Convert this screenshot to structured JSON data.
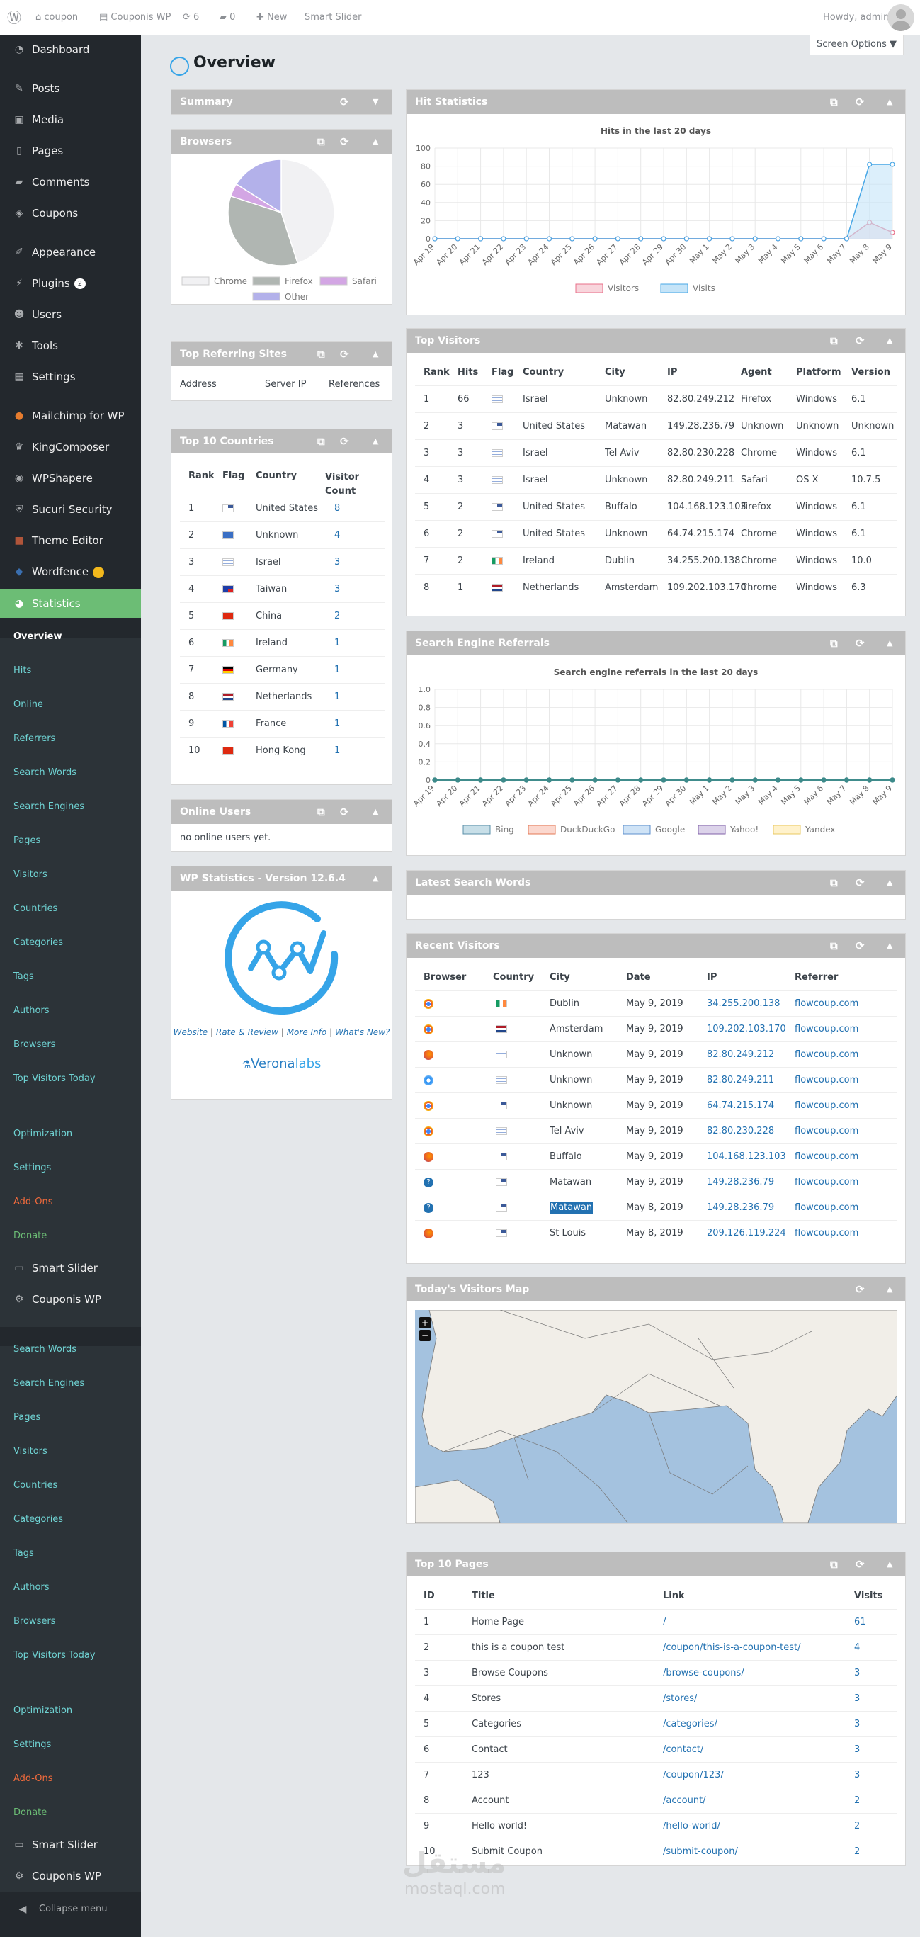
{
  "adminbar": {
    "site": "coupon",
    "site2": "Couponis WP",
    "updates": "6",
    "comments": "0",
    "new": "New",
    "smart_slider": "Smart Slider",
    "howdy": "Howdy, ",
    "user": "admin"
  },
  "menu": {
    "dashboard": "Dashboard",
    "posts": "Posts",
    "media": "Media",
    "pages": "Pages",
    "comments": "Comments",
    "coupons": "Coupons",
    "appearance": "Appearance",
    "plugins": "Plugins",
    "plugins_badge": "2",
    "users": "Users",
    "tools": "Tools",
    "settings": "Settings",
    "mailchimp": "Mailchimp for WP",
    "kingcomposer": "KingComposer",
    "wpshapere": "WPShapere",
    "sucuri": "Sucuri Security",
    "theme_editor": "Theme Editor",
    "wordfence": "Wordfence",
    "statistics": "Statistics",
    "sub1": [
      "Overview",
      "Hits",
      "Online",
      "Referrers",
      "Search Words",
      "Search Engines",
      "Pages",
      "Visitors",
      "Countries",
      "Categories",
      "Tags",
      "Authors",
      "Browsers",
      "Top Visitors Today",
      "Optimization",
      "Settings",
      "Add-Ons",
      "Donate"
    ],
    "smart_slider": "Smart Slider",
    "couponis": "Couponis WP",
    "sub2": [
      "Search Words",
      "Search Engines",
      "Pages",
      "Visitors",
      "Countries",
      "Categories",
      "Tags",
      "Authors",
      "Browsers",
      "Top Visitors Today",
      "Optimization",
      "Settings",
      "Add-Ons",
      "Donate"
    ],
    "smart_slider2": "Smart Slider",
    "couponis2": "Couponis WP",
    "collapse": "Collapse menu"
  },
  "page": {
    "title": "Overview",
    "screen_options": "Screen Options ▼"
  },
  "summary": {
    "title": "Summary"
  },
  "browsers": {
    "title": "Browsers",
    "legend": [
      "Chrome",
      "Firefox",
      "Safari",
      "Other"
    ],
    "colors": {
      "chrome": "#f1f1f3",
      "firefox": "#b0b6b2",
      "safari": "#d3a6e4",
      "other": "#b3b1ea"
    }
  },
  "referring": {
    "title": "Top Referring Sites",
    "cols": [
      "Address",
      "Server IP",
      "References"
    ]
  },
  "countries": {
    "title": "Top 10 Countries",
    "cols": [
      "Rank",
      "Flag",
      "Country",
      "Visitor Count"
    ],
    "rows": [
      [
        "1",
        "United States",
        "8"
      ],
      [
        "2",
        "Unknown",
        "4"
      ],
      [
        "3",
        "Israel",
        "3"
      ],
      [
        "4",
        "Taiwan",
        "3"
      ],
      [
        "5",
        "China",
        "2"
      ],
      [
        "6",
        "Ireland",
        "1"
      ],
      [
        "7",
        "Germany",
        "1"
      ],
      [
        "8",
        "Netherlands",
        "1"
      ],
      [
        "9",
        "France",
        "1"
      ],
      [
        "10",
        "Hong Kong",
        "1"
      ]
    ]
  },
  "online": {
    "title": "Online Users",
    "text": "no online users yet."
  },
  "version": {
    "title": "WP Statistics - Version 12.6.4",
    "links": [
      "Website",
      "Rate & Review",
      "More Info",
      "What's New?"
    ],
    "sep": "|",
    "logo_a": "Verona",
    "logo_b": "labs"
  },
  "hits": {
    "title": "Hit Statistics",
    "chart_title": "Hits in the last 20 days",
    "legend": [
      "Visitors",
      "Visits"
    ]
  },
  "chart_data": [
    {
      "type": "line",
      "title": "Hits in the last 20 days",
      "x": [
        "Apr 19",
        "Apr 20",
        "Apr 21",
        "Apr 22",
        "Apr 23",
        "Apr 24",
        "Apr 25",
        "Apr 26",
        "Apr 27",
        "Apr 28",
        "Apr 29",
        "Apr 30",
        "May 1",
        "May 2",
        "May 3",
        "May 4",
        "May 5",
        "May 6",
        "May 7",
        "May 8",
        "May 9"
      ],
      "series": [
        {
          "name": "Visitors",
          "values": [
            0,
            0,
            0,
            0,
            0,
            0,
            0,
            0,
            0,
            0,
            0,
            0,
            0,
            0,
            0,
            0,
            0,
            0,
            0,
            18,
            7
          ],
          "color": "#e8708a"
        },
        {
          "name": "Visits",
          "values": [
            0,
            0,
            0,
            0,
            0,
            0,
            0,
            0,
            0,
            0,
            0,
            0,
            0,
            0,
            0,
            0,
            0,
            0,
            0,
            82,
            82
          ],
          "color": "#48a7e6"
        }
      ],
      "ylim": [
        0,
        100
      ],
      "yticks": [
        "0",
        "20",
        "40",
        "60",
        "80",
        "100"
      ]
    },
    {
      "type": "line",
      "title": "Search engine referrals in the last 20 days",
      "x": [
        "Apr 19",
        "Apr 20",
        "Apr 21",
        "Apr 22",
        "Apr 23",
        "Apr 24",
        "Apr 25",
        "Apr 26",
        "Apr 27",
        "Apr 28",
        "Apr 29",
        "Apr 30",
        "May 1",
        "May 2",
        "May 3",
        "May 4",
        "May 5",
        "May 6",
        "May 7",
        "May 8",
        "May 9"
      ],
      "series": [
        {
          "name": "Bing",
          "values": [
            0,
            0,
            0,
            0,
            0,
            0,
            0,
            0,
            0,
            0,
            0,
            0,
            0,
            0,
            0,
            0,
            0,
            0,
            0,
            0,
            0
          ]
        },
        {
          "name": "DuckDuckGo",
          "values": [
            0,
            0,
            0,
            0,
            0,
            0,
            0,
            0,
            0,
            0,
            0,
            0,
            0,
            0,
            0,
            0,
            0,
            0,
            0,
            0,
            0
          ]
        },
        {
          "name": "Google",
          "values": [
            0,
            0,
            0,
            0,
            0,
            0,
            0,
            0,
            0,
            0,
            0,
            0,
            0,
            0,
            0,
            0,
            0,
            0,
            0,
            0,
            0
          ]
        },
        {
          "name": "Yahoo!",
          "values": [
            0,
            0,
            0,
            0,
            0,
            0,
            0,
            0,
            0,
            0,
            0,
            0,
            0,
            0,
            0,
            0,
            0,
            0,
            0,
            0,
            0
          ]
        },
        {
          "name": "Yandex",
          "values": [
            0,
            0,
            0,
            0,
            0,
            0,
            0,
            0,
            0,
            0,
            0,
            0,
            0,
            0,
            0,
            0,
            0,
            0,
            0,
            0,
            0
          ]
        }
      ],
      "ylim": [
        0,
        1
      ],
      "yticks": [
        "0",
        "0.2",
        "0.4",
        "0.6",
        "0.8",
        "1.0"
      ]
    },
    {
      "type": "pie",
      "title": "",
      "categories": [
        "Chrome",
        "Firefox",
        "Safari",
        "Other"
      ],
      "values": [
        45,
        35,
        4,
        16
      ]
    }
  ],
  "topvisitors": {
    "title": "Top Visitors",
    "cols": [
      "Rank",
      "Hits",
      "Flag",
      "Country",
      "City",
      "IP",
      "Agent",
      "Platform",
      "Version"
    ],
    "rows": [
      [
        "1",
        "66",
        "Israel",
        "Unknown",
        "82.80.249.212",
        "Firefox",
        "Windows",
        "6.1"
      ],
      [
        "2",
        "3",
        "United States",
        "Matawan",
        "149.28.236.79",
        "Unknown",
        "Unknown",
        "Unknown"
      ],
      [
        "3",
        "3",
        "Israel",
        "Tel Aviv",
        "82.80.230.228",
        "Chrome",
        "Windows",
        "6.1"
      ],
      [
        "4",
        "3",
        "Israel",
        "Unknown",
        "82.80.249.211",
        "Safari",
        "OS X",
        "10.7.5"
      ],
      [
        "5",
        "2",
        "United States",
        "Buffalo",
        "104.168.123.103",
        "Firefox",
        "Windows",
        "6.1"
      ],
      [
        "6",
        "2",
        "United States",
        "Unknown",
        "64.74.215.174",
        "Chrome",
        "Windows",
        "6.1"
      ],
      [
        "7",
        "2",
        "Ireland",
        "Dublin",
        "34.255.200.138",
        "Chrome",
        "Windows",
        "10.0"
      ],
      [
        "8",
        "1",
        "Netherlands",
        "Amsterdam",
        "109.202.103.170",
        "Chrome",
        "Windows",
        "6.3"
      ]
    ]
  },
  "search": {
    "title": "Search Engine Referrals",
    "chart_title": "Search engine referrals in the last 20 days",
    "legend": [
      "Bing",
      "DuckDuckGo",
      "Google",
      "Yahoo!",
      "Yandex"
    ]
  },
  "words": {
    "title": "Latest Search Words"
  },
  "recent": {
    "title": "Recent Visitors",
    "cols": [
      "Browser",
      "Country",
      "City",
      "Date",
      "IP",
      "Referrer"
    ],
    "rows": [
      [
        "Dublin",
        "May 9, 2019",
        "34.255.200.138",
        "flowcoup.com"
      ],
      [
        "Amsterdam",
        "May 9, 2019",
        "109.202.103.170",
        "flowcoup.com"
      ],
      [
        "Unknown",
        "May 9, 2019",
        "82.80.249.212",
        "flowcoup.com"
      ],
      [
        "Unknown",
        "May 9, 2019",
        "82.80.249.211",
        "flowcoup.com"
      ],
      [
        "Unknown",
        "May 9, 2019",
        "64.74.215.174",
        "flowcoup.com"
      ],
      [
        "Tel Aviv",
        "May 9, 2019",
        "82.80.230.228",
        "flowcoup.com"
      ],
      [
        "Buffalo",
        "May 9, 2019",
        "104.168.123.103",
        "flowcoup.com"
      ],
      [
        "Matawan",
        "May 9, 2019",
        "149.28.236.79",
        "flowcoup.com"
      ],
      [
        "Matawan",
        "May 8, 2019",
        "149.28.236.79",
        "flowcoup.com"
      ],
      [
        "St Louis",
        "May 8, 2019",
        "209.126.119.224",
        "flowcoup.com"
      ]
    ]
  },
  "map": {
    "title": "Today's Visitors Map",
    "zoom_in": "+",
    "zoom_out": "−"
  },
  "toppages": {
    "title": "Top 10 Pages",
    "cols": [
      "ID",
      "Title",
      "Link",
      "Visits"
    ],
    "rows": [
      [
        "1",
        "Home Page",
        "/",
        "61"
      ],
      [
        "2",
        "this is a coupon test",
        "/coupon/this-is-a-coupon-test/",
        "4"
      ],
      [
        "3",
        "Browse Coupons",
        "/browse-coupons/",
        "3"
      ],
      [
        "4",
        "Stores",
        "/stores/",
        "3"
      ],
      [
        "5",
        "Categories",
        "/categories/",
        "3"
      ],
      [
        "6",
        "Contact",
        "/contact/",
        "3"
      ],
      [
        "7",
        "123",
        "/coupon/123/",
        "3"
      ],
      [
        "8",
        "Account",
        "/account/",
        "2"
      ],
      [
        "9",
        "Hello world!",
        "/hello-world/",
        "2"
      ],
      [
        "10",
        "Submit Coupon",
        "/submit-coupon/",
        "2"
      ]
    ]
  },
  "watermark": {
    "ar": "مستقل",
    "en": "mostaql.com"
  }
}
